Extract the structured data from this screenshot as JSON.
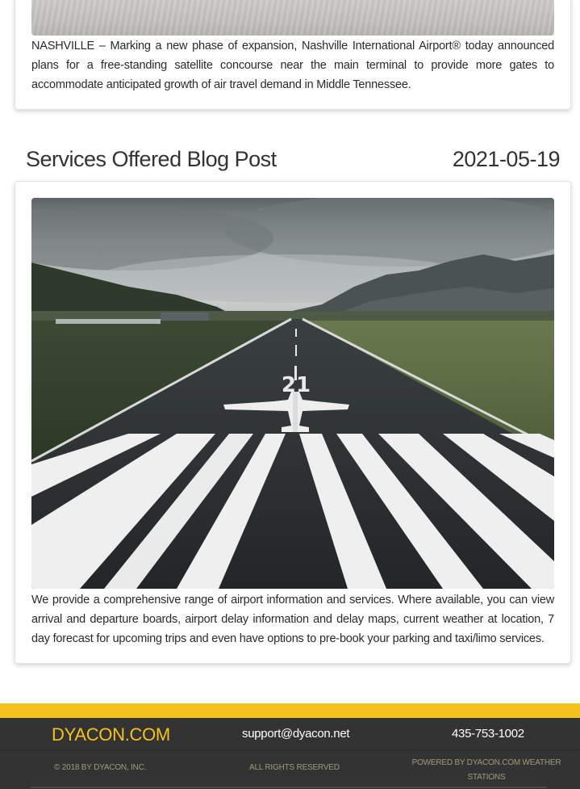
{
  "posts": [
    {
      "excerpt": "NASHVILLE – Marking a new phase of expansion, Nashville International Airport® today announced plans for a free-standing satellite concourse near the main terminal to provide more gates to accommodate anticipated growth of air travel demand in Middle Tennessee."
    },
    {
      "title": "Services Offered Blog Post",
      "date": "2021-05-19",
      "excerpt": "We provide a comprehensive range of airport information and services. Where available, you can view arrival and departure boards, airport delay information and delay maps, current weather at location, 7 day forecast for upcoming trips and even have options to pre-book your parking and taxi/limo services."
    }
  ],
  "footer": {
    "brand": "DYACON.COM",
    "email": "support@dyacon.net",
    "phone": "435-753-1002",
    "copyright": "© 2018 BY DYACON, INC.",
    "rights": "ALL RIGHTS RESERVED",
    "powered": "POWERED BY DYACON.COM WEATHER STATIONS"
  },
  "colors": {
    "accent": "#f3c21b",
    "footer_bg": "#333333",
    "footer_muted": "#a39a7a"
  }
}
